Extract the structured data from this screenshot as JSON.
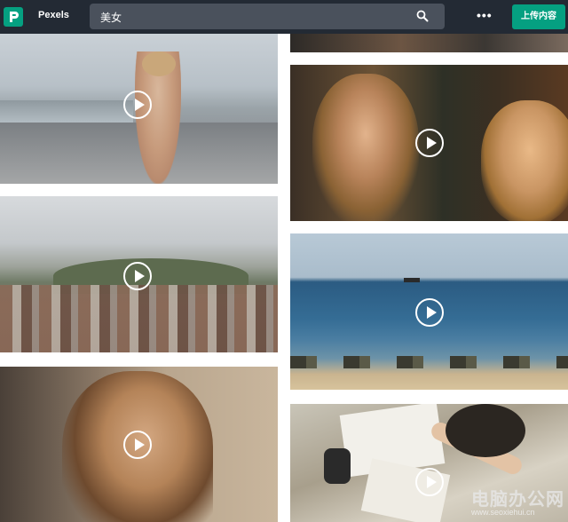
{
  "header": {
    "brand": "Pexels",
    "search_value": "美女",
    "more_label": "•••",
    "upload_label": "上传内容"
  },
  "colors": {
    "topbar": "#232a34",
    "search_bg": "#4a515c",
    "accent": "#05a081"
  },
  "icons": {
    "logo": "pexels-logo-icon",
    "search": "search-icon",
    "play": "play-icon"
  },
  "watermark": {
    "title": "电脑办公网",
    "url": "www.seoxiehui.cn"
  }
}
